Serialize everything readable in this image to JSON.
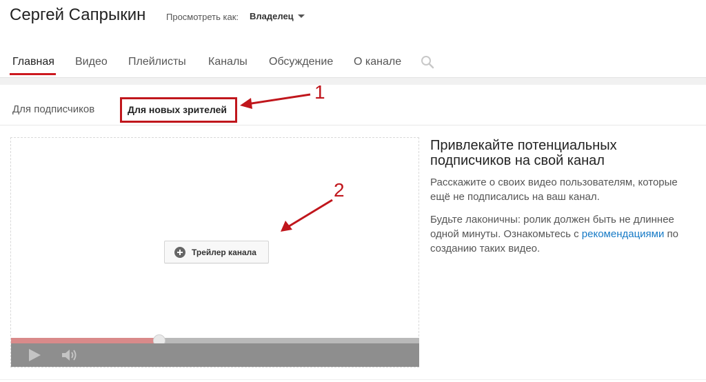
{
  "header": {
    "channel_name": "Сергей Сапрыкин",
    "view_as_label": "Просмотреть как:",
    "view_as_value": "Владелец"
  },
  "tabs": [
    {
      "label": "Главная",
      "active": true
    },
    {
      "label": "Видео"
    },
    {
      "label": "Плейлисты"
    },
    {
      "label": "Каналы"
    },
    {
      "label": "Обсуждение"
    },
    {
      "label": "О канале"
    }
  ],
  "subtabs": [
    {
      "label": "Для подписчиков"
    },
    {
      "label": "Для новых зрителей",
      "active": true
    }
  ],
  "annotations": {
    "one": "1",
    "two": "2"
  },
  "player": {
    "trailer_button": "Трейлер канала",
    "progress": 0.36
  },
  "promo": {
    "title": "Привлекайте потенциальных подписчиков на свой канал",
    "p1": "Расскажите о своих видео пользователям, которые ещё не подписались на ваш канал.",
    "p2_before": "Будьте лаконичны: ролик должен быть не длиннее одной минуты. Ознакомьтесь с ",
    "p2_link": "рекомендациями",
    "p2_after": " по созданию таких видео."
  },
  "colors": {
    "accent": "#cc181e",
    "annotation": "#c0161c",
    "link": "#167ac6"
  },
  "icons": [
    "search-icon",
    "plus-icon",
    "play-icon",
    "volume-icon",
    "chevron-down-icon"
  ]
}
